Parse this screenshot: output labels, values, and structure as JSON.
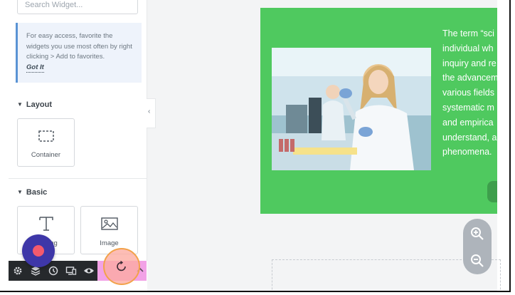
{
  "sidebar": {
    "search": {
      "placeholder": "Search Widget..."
    },
    "tip": {
      "text": "For easy access, favorite the widgets you use most often by right clicking > Add to favorites.",
      "link": "Got It"
    },
    "sections": [
      {
        "title": "Layout",
        "widgets": [
          {
            "label": "Container",
            "icon": "container-icon"
          }
        ]
      },
      {
        "title": "Basic",
        "widgets": [
          {
            "label": "Heading",
            "visible_label": "ing",
            "icon": "heading-icon"
          },
          {
            "label": "Image",
            "icon": "image-icon"
          }
        ]
      }
    ]
  },
  "toolbar": {
    "icons": [
      "settings-icon",
      "layers-icon",
      "history-icon",
      "responsive-icon",
      "preview-icon"
    ],
    "publish_area_icon": "refresh-icon",
    "expand_icon": "chevron-up-icon"
  },
  "canvas": {
    "hero": {
      "background": "#4fc95f",
      "text_lines": [
        "The term “sci",
        "individual wh",
        "inquiry and re",
        "the advancem",
        "various fields",
        "systematic m",
        "and empirica",
        "understand, a",
        "phenomena."
      ],
      "image_alt": "scientist using pipette in laboratory"
    },
    "zoom": {
      "in_icon": "zoom-in-icon",
      "out_icon": "zoom-out-icon"
    }
  },
  "colors": {
    "accent": "#3e37a8",
    "fab_dot": "#f45a6d",
    "tip_border": "#5a93d4",
    "toolbar_bg": "#26292c",
    "highlight": "#f2a2e6"
  }
}
